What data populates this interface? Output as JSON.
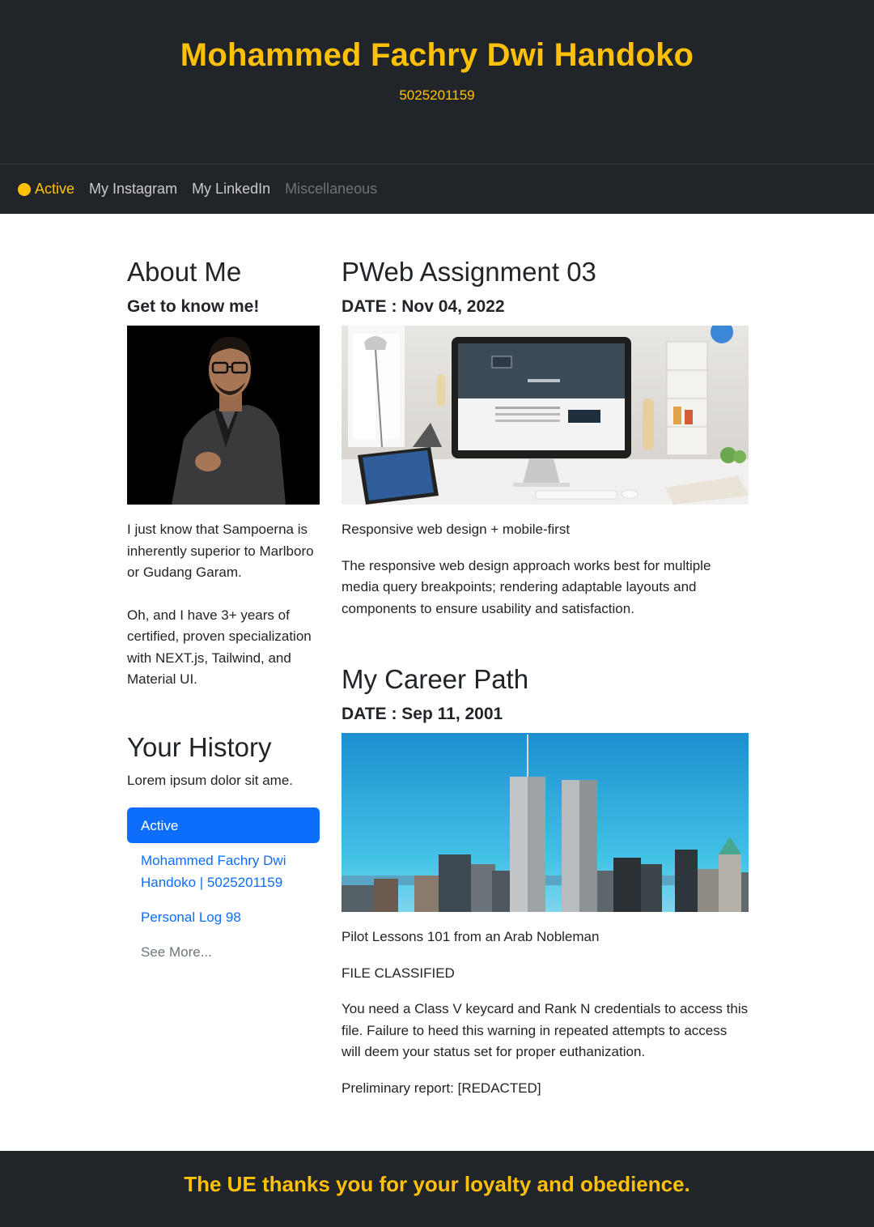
{
  "header": {
    "title": "Mohammed Fachry Dwi Handoko",
    "nrp": "5025201159"
  },
  "nav": {
    "items": [
      {
        "label": "Active"
      },
      {
        "label": "My Instagram"
      },
      {
        "label": "My LinkedIn"
      },
      {
        "label": "Miscellaneous"
      }
    ]
  },
  "about": {
    "heading": "About Me",
    "subheading": "Get to know me!",
    "para1": "I just know that Sampoerna is inherently superior to Marlboro or Gudang Garam.",
    "para2": "Oh, and I have 3+ years of certified, proven specialization with NEXT.js, Tailwind, and Material UI."
  },
  "history": {
    "heading": "Your History",
    "text": "Lorem ipsum dolor sit ame.",
    "items": [
      {
        "label": "Active"
      },
      {
        "label": "Mohammed Fachry Dwi Handoko | 5025201159"
      },
      {
        "label": "Personal Log 98"
      },
      {
        "label": "See More..."
      }
    ]
  },
  "posts": [
    {
      "title": "PWeb Assignment 03",
      "date": "DATE : Nov 04, 2022",
      "caption": "Responsive web design + mobile-first",
      "body": "The responsive web design approach works best for multiple media query breakpoints; rendering adaptable layouts and components to ensure usability and satisfaction."
    },
    {
      "title": "My Career Path",
      "date": "DATE : Sep 11, 2001",
      "caption": "Pilot Lessons 101 from an Arab Nobleman",
      "classified": "FILE CLASSIFIED",
      "body": "You need a Class V keycard and Rank N credentials to access this file. Failure to heed this warning in repeated attempts to access will deem your status set for proper euthanization.",
      "report": "Preliminary report: [REDACTED]"
    }
  ],
  "footer": {
    "message": "The UE thanks you for your loyalty and obedience."
  },
  "colors": {
    "accent": "#ffc107",
    "dark": "#212529",
    "primary": "#0d6efd"
  }
}
